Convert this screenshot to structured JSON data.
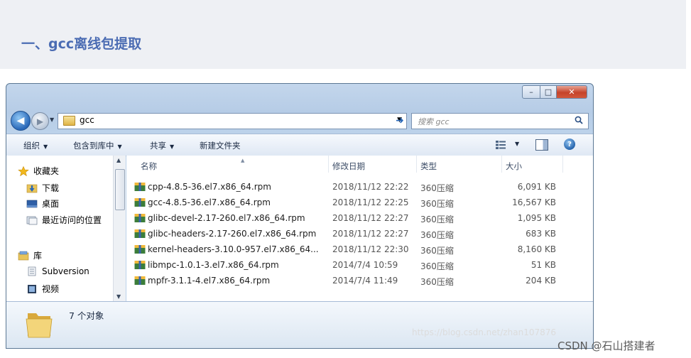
{
  "article": {
    "heading": "一、gcc离线包提取"
  },
  "window": {
    "caption": {
      "minimize": "–",
      "maximize": "□",
      "close": "✕"
    },
    "address": {
      "path": "gcc"
    },
    "search": {
      "placeholder": "搜索 gcc"
    },
    "toolbar": {
      "organize": "组织",
      "include_library": "包含到库中",
      "share": "共享",
      "new_folder": "新建文件夹"
    },
    "nav": {
      "favorites": "收藏夹",
      "downloads": "下载",
      "desktop": "桌面",
      "recent": "最近访问的位置",
      "libraries": "库",
      "subversion": "Subversion",
      "videos": "视频"
    },
    "columns": {
      "name": "名称",
      "date": "修改日期",
      "type": "类型",
      "size": "大小"
    },
    "files": [
      {
        "name": "cpp-4.8.5-36.el7.x86_64.rpm",
        "date": "2018/11/12 22:22",
        "type": "360压缩",
        "size": "6,091 KB"
      },
      {
        "name": "gcc-4.8.5-36.el7.x86_64.rpm",
        "date": "2018/11/12 22:25",
        "type": "360压缩",
        "size": "16,567 KB"
      },
      {
        "name": "glibc-devel-2.17-260.el7.x86_64.rpm",
        "date": "2018/11/12 22:27",
        "type": "360压缩",
        "size": "1,095 KB"
      },
      {
        "name": "glibc-headers-2.17-260.el7.x86_64.rpm",
        "date": "2018/11/12 22:27",
        "type": "360压缩",
        "size": "683 KB"
      },
      {
        "name": "kernel-headers-3.10.0-957.el7.x86_64...",
        "date": "2018/11/12 22:30",
        "type": "360压缩",
        "size": "8,160 KB"
      },
      {
        "name": "libmpc-1.0.1-3.el7.x86_64.rpm",
        "date": "2014/7/4 10:59",
        "type": "360压缩",
        "size": "51 KB"
      },
      {
        "name": "mpfr-3.1.1-4.el7.x86_64.rpm",
        "date": "2014/7/4 11:49",
        "type": "360压缩",
        "size": "204 KB"
      }
    ],
    "status": {
      "object_count": "7 个对象"
    }
  },
  "watermarks": {
    "url": "https://blog.csdn.net/zhan107876",
    "csdn": "CSDN @石山搭建者"
  },
  "colors": {
    "heading": "#4b6cb3",
    "heading_bg": "#eef0f4",
    "window_frame": "#bcd2ea",
    "close_button": "#c5432a"
  }
}
